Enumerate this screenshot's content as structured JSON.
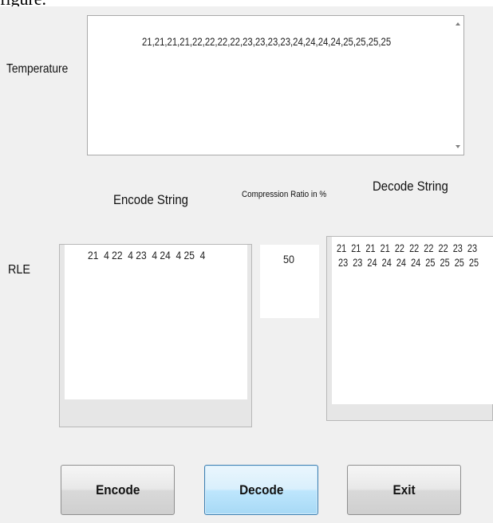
{
  "header": {
    "clipped_caption": "figure."
  },
  "temperature": {
    "label": "Temperature",
    "value": "21,21,21,21,22,22,22,22,23,23,23,23,24,24,24,24,25,25,25,25"
  },
  "encode": {
    "heading": "Encode String",
    "row_label": "RLE",
    "value": "21  4 22  4 23  4 24  4 25  4"
  },
  "compression": {
    "heading": "Compression Ratio in %",
    "value": "50"
  },
  "decode": {
    "heading": "Decode String",
    "line1": "21  21  21  21  22  22  22  22  23  23",
    "line2": "23  23  24  24  24  24  25  25  25  25"
  },
  "buttons": {
    "encode_label": "Encode",
    "decode_label": "Decode",
    "exit_label": "Exit"
  }
}
